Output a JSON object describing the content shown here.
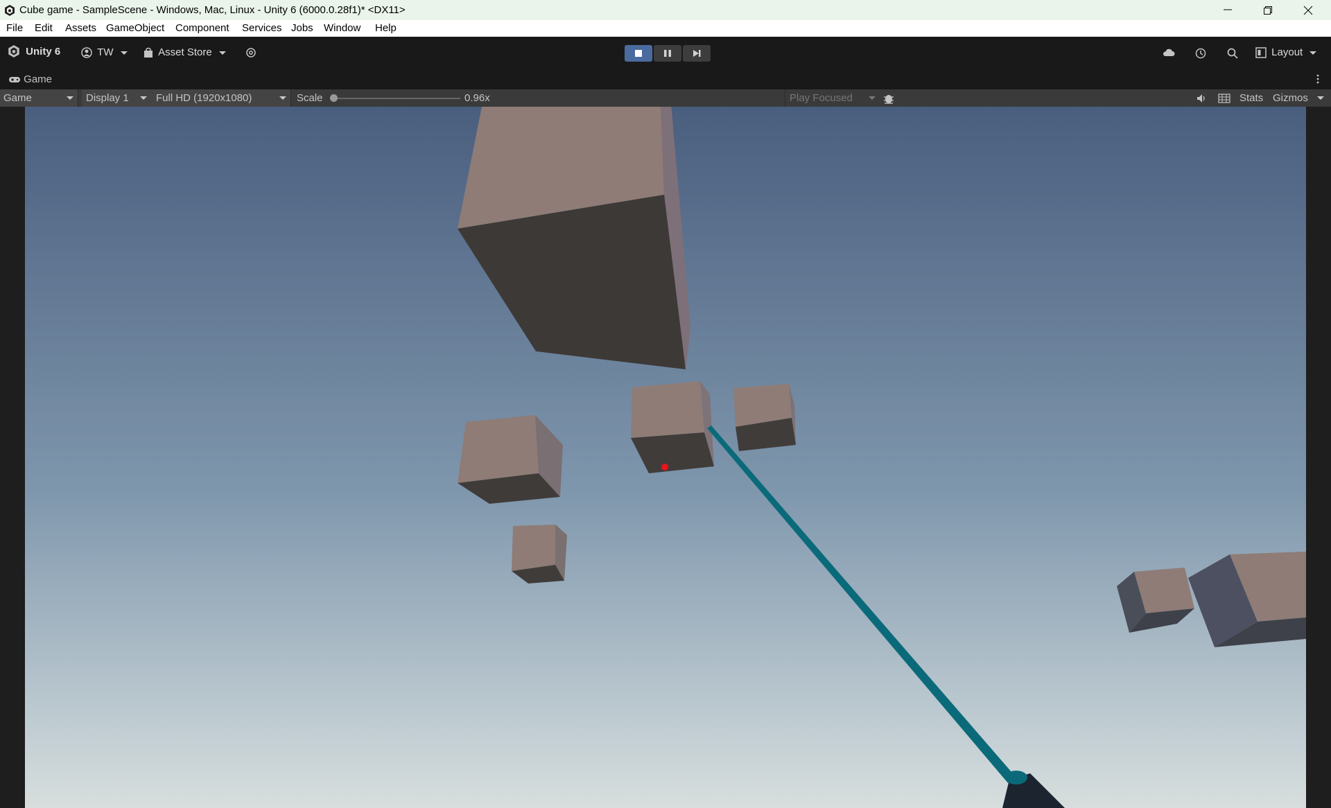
{
  "window": {
    "title": "Cube game - SampleScene - Windows, Mac, Linux - Unity 6 (6000.0.28f1)* <DX11>",
    "controls": [
      "minimize",
      "restore",
      "close"
    ]
  },
  "menu": {
    "items": [
      "File",
      "Edit",
      "Assets",
      "GameObject",
      "Component",
      "Services",
      "Jobs",
      "Window",
      "Help"
    ]
  },
  "toolbar": {
    "unity_label": "Unity 6",
    "account_label": "TW",
    "asset_store_label": "Asset Store",
    "layout_label": "Layout",
    "play_state": "playing"
  },
  "tab": {
    "label": "Game"
  },
  "game_toolbar": {
    "mode": "Game",
    "display": "Display 1",
    "resolution": "Full HD (1920x1080)",
    "scale_label": "Scale",
    "scale_value": "0.96x",
    "play_focus": "Play Focused",
    "stats_label": "Stats",
    "gizmos_label": "Gizmos"
  },
  "colors": {
    "sky_top": "#4a5e7e",
    "sky_bottom": "#cfd8d9",
    "cube_light": "#8f7c76",
    "cube_dark": "#3d3937",
    "laser": "#0b6a7a",
    "crosshair": "#e8131b",
    "play_active": "#4a6b9e"
  },
  "icons": [
    "unity-logo-icon",
    "account-icon",
    "asset-store-bag-icon",
    "cloud-icon",
    "history-icon",
    "search-icon",
    "layout-icon",
    "gamepad-icon",
    "kebab-menu-icon",
    "bug-icon",
    "audio-icon",
    "grid-icon",
    "stop-icon",
    "pause-icon",
    "step-icon"
  ]
}
